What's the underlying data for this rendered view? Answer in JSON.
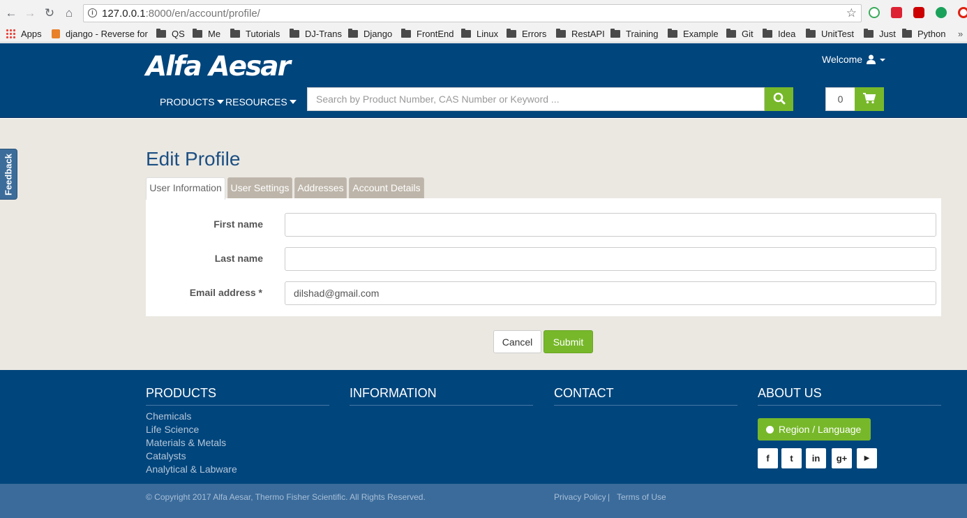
{
  "browser": {
    "url_host": "127.0.0.1",
    "url_rest": ":8000/en/account/profile/",
    "bookmarks": [
      {
        "label": "Apps"
      },
      {
        "label": "django - Reverse for"
      },
      {
        "label": "QS"
      },
      {
        "label": "Me"
      },
      {
        "label": "Tutorials"
      },
      {
        "label": "DJ-Trans"
      },
      {
        "label": "Django"
      },
      {
        "label": "FrontEnd"
      },
      {
        "label": "Linux"
      },
      {
        "label": "Errors"
      },
      {
        "label": "RestAPI"
      },
      {
        "label": "Training"
      },
      {
        "label": "Example"
      },
      {
        "label": "Git"
      },
      {
        "label": "Idea"
      },
      {
        "label": "UnitTest"
      },
      {
        "label": "Just"
      },
      {
        "label": "Python"
      }
    ]
  },
  "header": {
    "logo": "Alfa Aesar",
    "welcome": "Welcome",
    "menu": [
      {
        "label": "PRODUCTS"
      },
      {
        "label": "RESOURCES"
      }
    ],
    "search_placeholder": "Search by Product Number, CAS Number or Keyword ...",
    "cart_count": "0",
    "brand_color": "#00457c",
    "accent_color": "#77b82a"
  },
  "main": {
    "feedback": "Feedback",
    "title": "Edit Profile",
    "tabs": [
      {
        "label": "User Information",
        "active": true
      },
      {
        "label": "User Settings"
      },
      {
        "label": "Addresses"
      },
      {
        "label": "Account Details"
      }
    ],
    "form": {
      "first_name_label": "First name",
      "first_name_value": "",
      "last_name_label": "Last name",
      "last_name_value": "",
      "email_label": "Email address *",
      "email_value": "dilshad@gmail.com"
    },
    "cancel": "Cancel",
    "submit": "Submit"
  },
  "footer": {
    "products_heading": "PRODUCTS",
    "information_heading": "INFORMATION",
    "contact_heading": "CONTACT",
    "about_heading": "ABOUT US",
    "product_links": [
      {
        "label": "Chemicals"
      },
      {
        "label": "Life Science"
      },
      {
        "label": "Materials & Metals"
      },
      {
        "label": "Catalysts"
      },
      {
        "label": "Analytical & Labware"
      }
    ],
    "region_button": "Region / Language",
    "social": [
      {
        "icon": "facebook-icon",
        "glyph": "f"
      },
      {
        "icon": "twitter-icon",
        "glyph": "t"
      },
      {
        "icon": "linkedin-icon",
        "glyph": "in"
      },
      {
        "icon": "google-plus-icon",
        "glyph": "g+"
      },
      {
        "icon": "youtube-icon",
        "glyph": "▶"
      }
    ],
    "copyright": "© Copyright 2017 Alfa Aesar, Thermo Fisher Scientific. All Rights Reserved.",
    "privacy": "Privacy Policy",
    "separator": "|",
    "terms": "Terms of Use"
  }
}
